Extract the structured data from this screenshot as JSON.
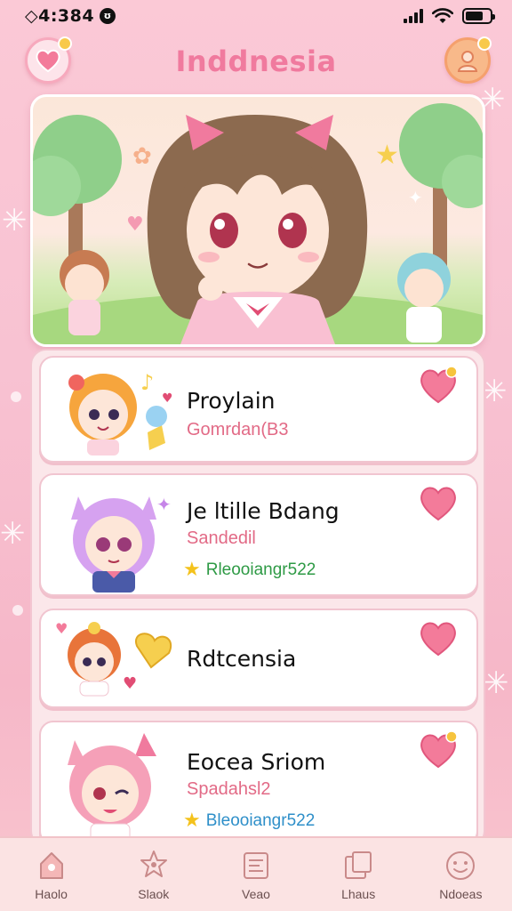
{
  "status_bar": {
    "time": "◇4:384",
    "badge": "ʊ"
  },
  "header": {
    "title": "Inddnesia"
  },
  "list": [
    {
      "title": "Proylain",
      "subtitle": "Gomrdan(B3",
      "rating": ""
    },
    {
      "title": "Je ltille Bdang",
      "subtitle": "Sandedil",
      "rating": "Rleooiangr522"
    },
    {
      "title": "Rdtcensia",
      "subtitle": "",
      "rating": ""
    },
    {
      "title": "Eocea Sriom",
      "subtitle": "Spadahsl2",
      "rating": "Bleooiangr522"
    }
  ],
  "bottom_nav": [
    {
      "label": "Haolo",
      "icon": "home-icon"
    },
    {
      "label": "Slaok",
      "icon": "sticker-icon"
    },
    {
      "label": "Veao",
      "icon": "video-icon"
    },
    {
      "label": "Lhaus",
      "icon": "gallery-icon"
    },
    {
      "label": "Ndoeas",
      "icon": "smile-icon"
    }
  ],
  "colors": {
    "accent": "#f07a9e",
    "heart": "#f37b9a",
    "background": "#fbc9d6"
  }
}
